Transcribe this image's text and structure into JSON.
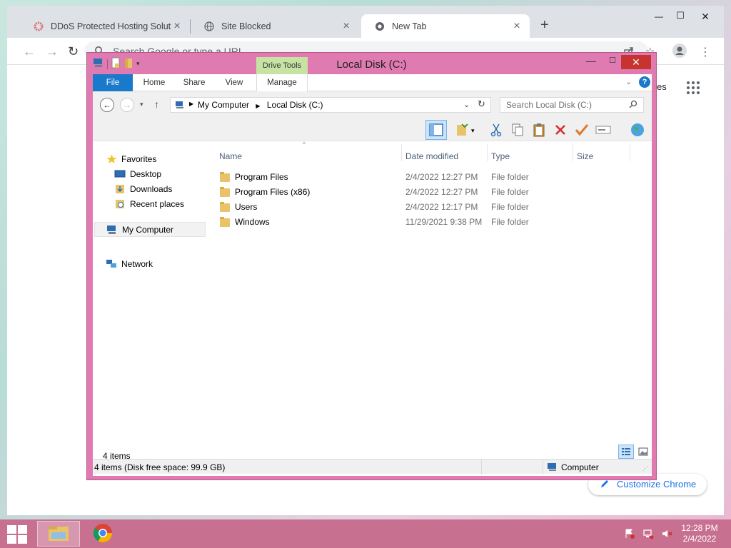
{
  "chrome": {
    "tabs": [
      {
        "label": "DDoS Protected Hosting Solution",
        "close": "×"
      },
      {
        "label": "Site Blocked",
        "close": "×"
      },
      {
        "label": "New Tab",
        "close": "×"
      }
    ],
    "new_tab": "+",
    "window_controls": {
      "minimize": "—",
      "maximize": "☐",
      "close": "✕"
    },
    "nav": {
      "back": "←",
      "forward": "→",
      "reload": "↻"
    },
    "omnibox_placeholder": "Search Google or type a URL",
    "page_fragment": "es",
    "customize_label": "Customize Chrome"
  },
  "explorer": {
    "title": "Local Disk (C:)",
    "context_tab": "Drive Tools",
    "ribbon_tabs": [
      "File",
      "Home",
      "Share",
      "View",
      "Manage"
    ],
    "address": {
      "parts": [
        "My Computer",
        "Local Disk (C:)"
      ]
    },
    "search_placeholder": "Search Local Disk (C:)",
    "nav_pane": {
      "favorites": "Favorites",
      "favorite_items": [
        "Desktop",
        "Downloads",
        "Recent places"
      ],
      "computer": "My Computer",
      "network": "Network"
    },
    "columns": {
      "name": "Name",
      "date": "Date modified",
      "type": "Type",
      "size": "Size"
    },
    "files": [
      {
        "name": "Program Files",
        "date": "2/4/2022 12:27 PM",
        "type": "File folder"
      },
      {
        "name": "Program Files (x86)",
        "date": "2/4/2022 12:27 PM",
        "type": "File folder"
      },
      {
        "name": "Users",
        "date": "2/4/2022 12:17 PM",
        "type": "File folder"
      },
      {
        "name": "Windows",
        "date": "11/29/2021 9:38 PM",
        "type": "File folder"
      }
    ],
    "items_count": "4 items",
    "status_left": "4 items (Disk free space: 99.9 GB)",
    "status_right": "Computer"
  },
  "taskbar": {
    "time": "12:28 PM",
    "date": "2/4/2022"
  },
  "colors": {
    "explorer_frame": "#e07bb1",
    "file_tab": "#1979ca",
    "drive_tools": "#c6e3a4",
    "taskbar": "#c8708f",
    "close_button": "#c7342f"
  }
}
